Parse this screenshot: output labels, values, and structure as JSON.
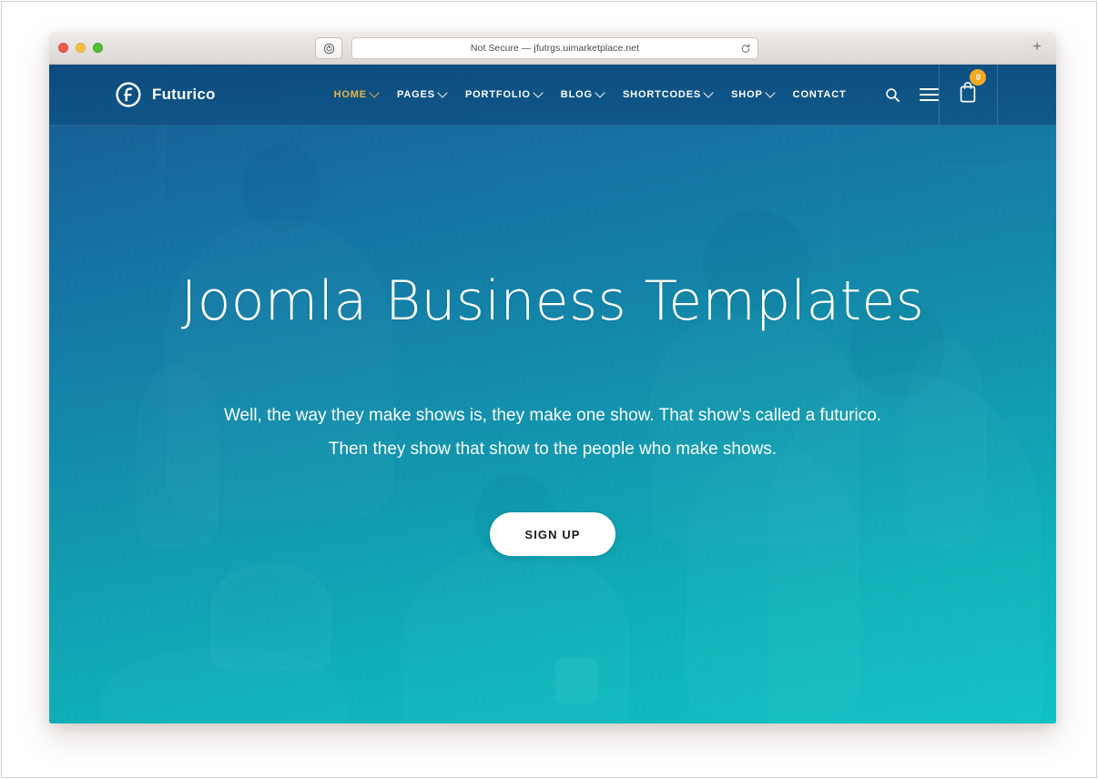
{
  "browser": {
    "url_text": "Not Secure — jfutrgs.uimarketplace.net",
    "reader_icon": "reader-view-icon",
    "reload_icon": "reload-icon",
    "newtab_label": "+",
    "traffic_lights": [
      "close",
      "minimize",
      "zoom"
    ]
  },
  "site": {
    "brand": {
      "name": "Futurico",
      "mark": "futurico-circle-f-logo"
    },
    "nav": [
      {
        "label": "HOME",
        "has_caret": true,
        "active": true
      },
      {
        "label": "PAGES",
        "has_caret": true,
        "active": false
      },
      {
        "label": "PORTFOLIO",
        "has_caret": true,
        "active": false
      },
      {
        "label": "BLOG",
        "has_caret": true,
        "active": false
      },
      {
        "label": "SHORTCODES",
        "has_caret": true,
        "active": false
      },
      {
        "label": "SHOP",
        "has_caret": true,
        "active": false
      },
      {
        "label": "CONTACT",
        "has_caret": false,
        "active": false
      }
    ],
    "tools": {
      "search_icon": "search-icon",
      "menu_icon": "hamburger-menu-icon",
      "cart_icon": "shopping-bag-icon",
      "cart_count": "0"
    },
    "hero": {
      "title": "Joomla Business Templates",
      "subtitle_line1": "Well, the way they make shows is, they make one show. That show's called a futurico.",
      "subtitle_line2": "Then they show that show to the people who make shows.",
      "cta_label": "SIGN UP"
    }
  },
  "colors": {
    "nav_active": "#e8b44a",
    "badge": "#f2a922",
    "overlay_top": "#125691",
    "overlay_bottom": "#0cc4c6",
    "cta_bg": "#ffffff"
  }
}
